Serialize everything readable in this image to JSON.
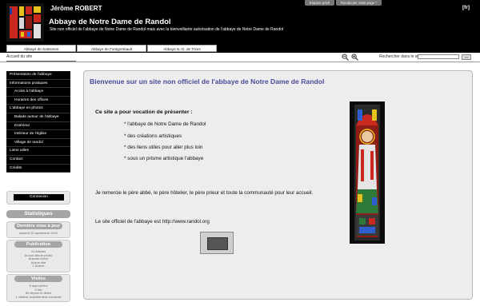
{
  "header": {
    "author": "Jérôme ROBERT",
    "title": "Abbaye de Notre Dame de Randol",
    "subtitle": "Site non officiel de l'abbaye de Notre Dame de Randol mais avec la bienveillante autorisation de l'abbaye de Notre Dame de Randol",
    "lang": "[fr]",
    "top_buttons": [
      "Espace privé",
      "Recalculer cette page *"
    ]
  },
  "tabs": [
    "Abbaye de Solesmes",
    "Abbaye de Fontgombault",
    "Abbaye N.-D. de Triors"
  ],
  "breadcrumb": "Accueil du site",
  "search": {
    "label": "Rechercher dans le site",
    "value": "",
    "button": ">>"
  },
  "nav": [
    {
      "label": "Présentation de l'abbaye",
      "sub": false
    },
    {
      "label": "Informations pratiques",
      "sub": false
    },
    {
      "label": "Accès à l'abbaye",
      "sub": true
    },
    {
      "label": "Horaires des offices",
      "sub": true
    },
    {
      "label": "L'abbaye en photos",
      "sub": false
    },
    {
      "label": "Balade autour de l'abbaye",
      "sub": true
    },
    {
      "label": "Extérieur",
      "sub": true
    },
    {
      "label": "Intérieur de l'église",
      "sub": true
    },
    {
      "label": "Village de randol",
      "sub": true
    },
    {
      "label": "Liens utiles",
      "sub": false
    },
    {
      "label": "Contact",
      "sub": false
    },
    {
      "label": "Crédits",
      "sub": false
    }
  ],
  "sidebar": {
    "connexion": "Connexion",
    "statistiques": "Statistiques",
    "derniere_maj": "Dernière mise à jour",
    "derniere_date": "samedi 22 septembre 2012",
    "publication": "Publication",
    "publication_lines": [
      "11 Articles",
      "Aucun album photo",
      "Aucune brève",
      "Aucun site",
      "1 Auteur"
    ],
    "visites": "Visites",
    "visites_lines": [
      "5 aujourd'hui",
      "1 hier",
      "84 depuis le début",
      "1 visiteur actuellement connecté"
    ]
  },
  "main": {
    "welcome": "Bienvenue sur un site non officiel de l'abbaye de Notre Dame de Randol",
    "intro": "Ce site a pour vocation de présenter :",
    "bullets": [
      "* l'abbaye de Notre Dame de Randol",
      "* des créations artistiques",
      "* des liens utiles pour aller plus loin",
      "* sous un prisme artistique l'abbaye"
    ],
    "thanks": "Je remercie le père abbé, le père hôtelier, le père prieur et toute la communauté pour leur accueil.",
    "official": "Le site officiel de l'abbaye est http://www.randol.org"
  },
  "icons": [
    "zoom-out-icon",
    "zoom-in-icon"
  ]
}
